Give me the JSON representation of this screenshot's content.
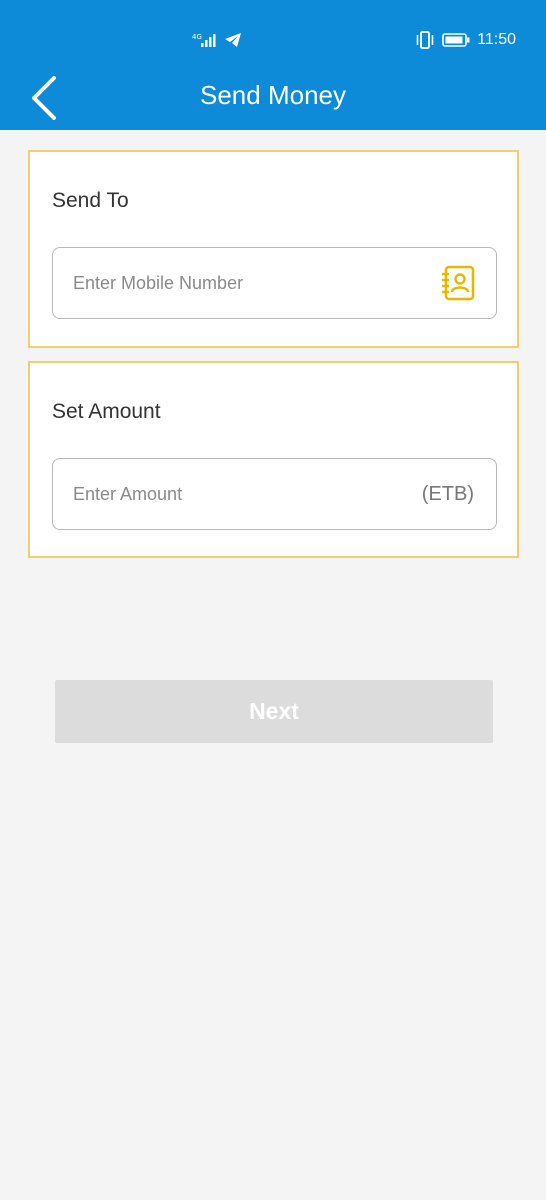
{
  "status_bar": {
    "time": "11:50",
    "icons": [
      "signal-icon",
      "telegram-icon",
      "vibrate-icon",
      "battery-icon"
    ]
  },
  "header": {
    "title": "Send Money",
    "back_icon": "chevron-left-icon",
    "background_color": "#0d8ad8"
  },
  "send_to": {
    "label": "Send To",
    "placeholder": "Enter Mobile Number",
    "value": "",
    "contact_icon": "contact-book-icon"
  },
  "amount": {
    "label": "Set Amount",
    "placeholder": "Enter Amount",
    "value": "",
    "unit": "(ETB)"
  },
  "next_button": {
    "label": "Next",
    "enabled": false
  },
  "colors": {
    "card_border": "#f2cd72",
    "contact_icon": "#e8b800",
    "disabled_button": "#dcdcdc"
  }
}
